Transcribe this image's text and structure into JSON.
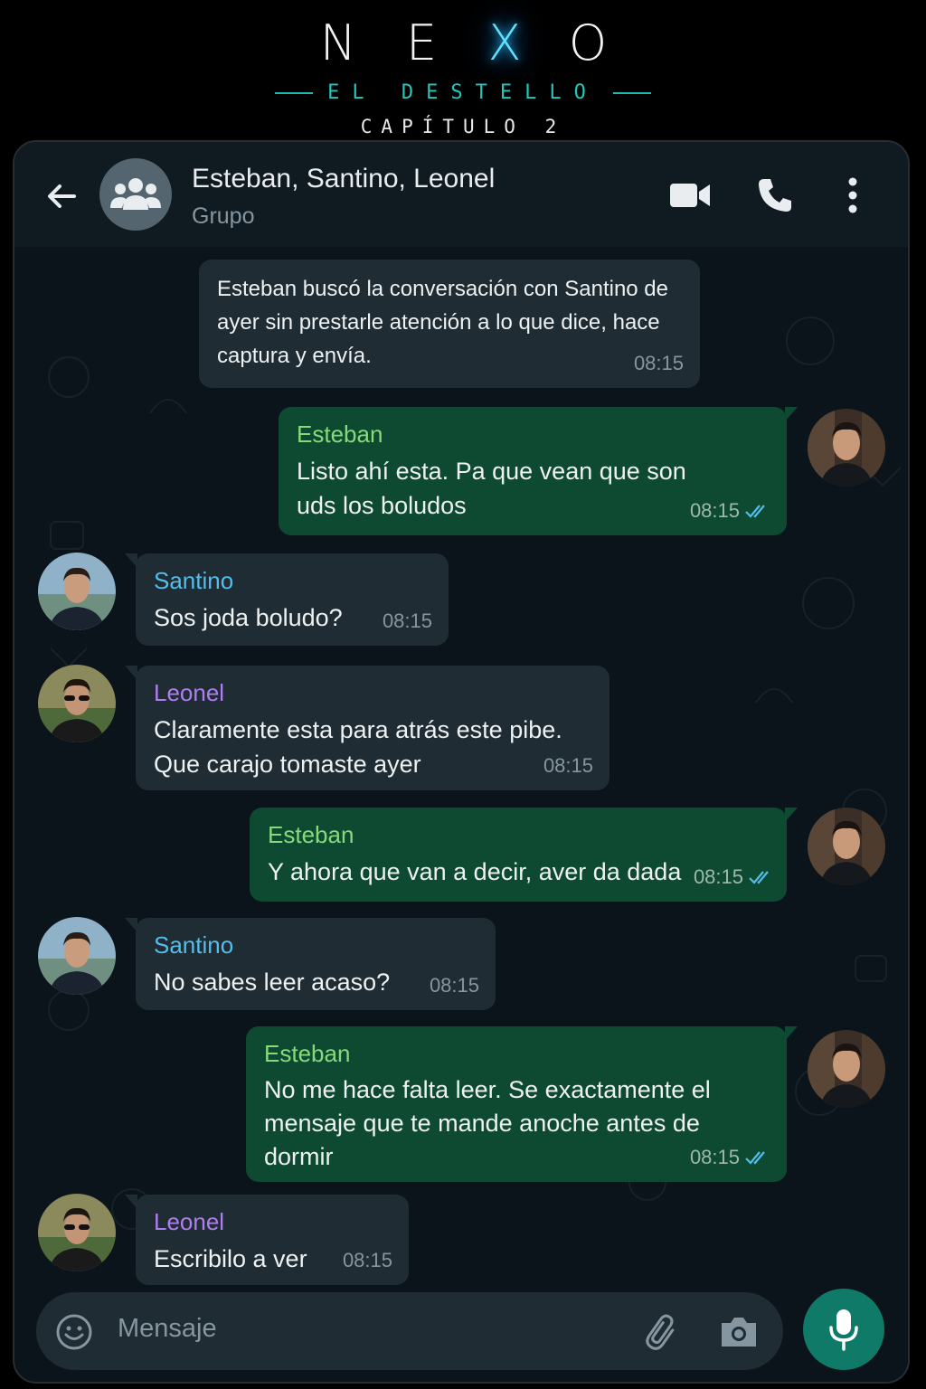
{
  "title": {
    "letters": [
      "N",
      "E",
      "X",
      "O"
    ],
    "subtitle": "EL DESTELLO",
    "chapter": "CAPÍTULO 2"
  },
  "header": {
    "chat_name": "Esteban, Santino, Leonel",
    "chat_type": "Grupo",
    "icons": [
      "back-arrow-icon",
      "group-icon",
      "video-call-icon",
      "phone-icon",
      "more-vert-icon"
    ]
  },
  "messages": [
    {
      "type": "system",
      "text": "Esteban buscó la conversación con Santino de ayer sin prestarle atención a lo que dice, hace captura y envía.",
      "time": "08:15"
    },
    {
      "type": "out",
      "sender": "Esteban",
      "text": "Listo ahí esta. Pa que vean que son uds los boludos",
      "time": "08:15"
    },
    {
      "type": "in",
      "sender": "Santino",
      "text": "Sos joda boludo?",
      "time": "08:15"
    },
    {
      "type": "in",
      "sender": "Leonel",
      "text": "Claramente esta para atrás este pibe. Que carajo tomaste ayer",
      "time": "08:15"
    },
    {
      "type": "out",
      "sender": "Esteban",
      "text": "Y ahora que van a decir, aver da dada",
      "time": "08:15"
    },
    {
      "type": "in",
      "sender": "Santino",
      "text": "No sabes leer acaso?",
      "time": "08:15"
    },
    {
      "type": "out",
      "sender": "Esteban",
      "text": "No me hace falta leer. Se exactamente el mensaje que te mande anoche antes de dormir",
      "time": "08:15"
    },
    {
      "type": "in",
      "sender": "Leonel",
      "text": "Escribilo a ver",
      "time": "08:15"
    }
  ],
  "input": {
    "placeholder": "Mensaje",
    "icons": [
      "emoji-icon",
      "attach-icon",
      "camera-icon",
      "mic-icon"
    ]
  },
  "colors": {
    "background": "#0b141a",
    "incoming_bubble": "#1f2c33",
    "outgoing_bubble": "#0e4a32",
    "esteban_name": "#88d97a",
    "santino_name": "#53bdeb",
    "leonel_name": "#b07df0",
    "read_ticks": "#53bdeb",
    "mic_button": "#0f7a68",
    "logo_x_glow": "#5fe0ff"
  }
}
